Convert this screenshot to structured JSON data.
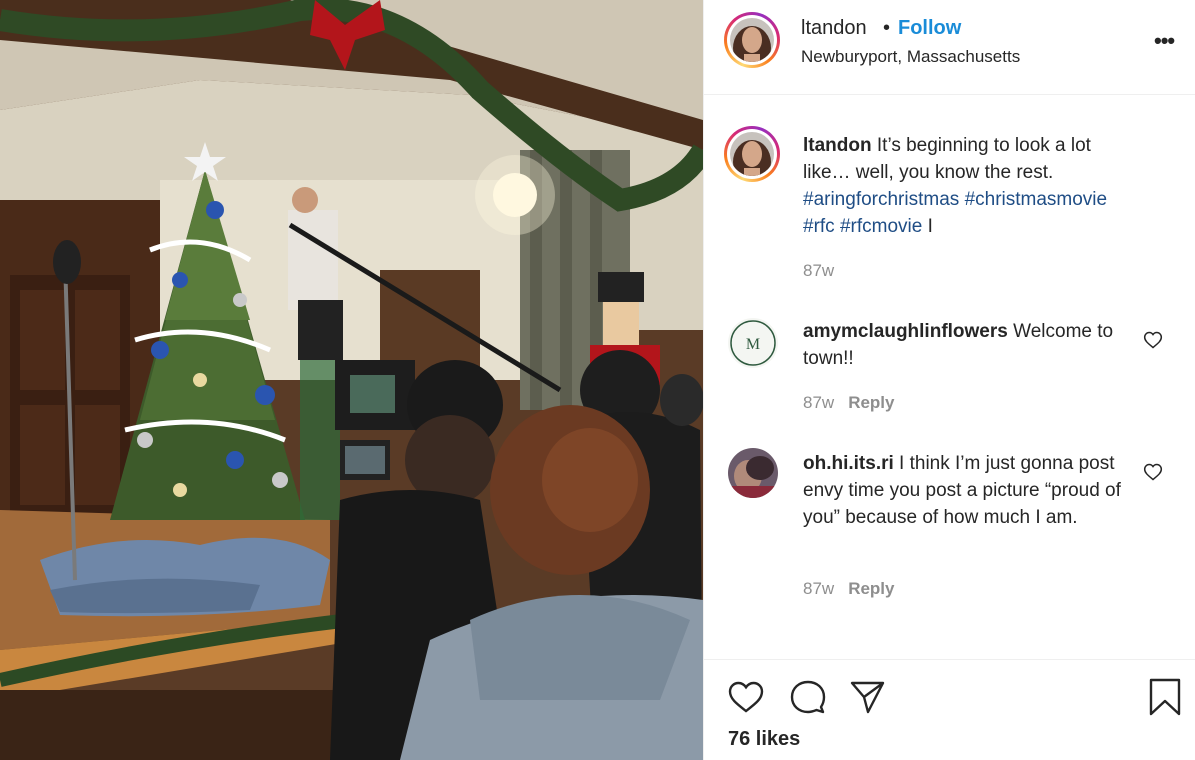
{
  "header": {
    "username": "ltandon",
    "separator": "•",
    "follow_label": "Follow",
    "location": "Newburyport, Massachusetts",
    "more_label": "•••"
  },
  "caption": {
    "username": "ltandon",
    "text": " It’s beginning to look a lot like… well, you know the rest. ",
    "hashtags": [
      "#aringforchristmas",
      "#christmasmovie",
      "#rfc",
      "#rfcmovie"
    ],
    "trailing": " I",
    "time": "87w"
  },
  "comments": [
    {
      "username": "amymclaughlinflowers",
      "text": " Welcome to town!!",
      "time": "87w",
      "reply_label": "Reply"
    },
    {
      "username": "oh.hi.its.ri",
      "text": " I think I’m just gonna post envy time you post a picture “proud of you” because of how much I am.",
      "time": "87w",
      "reply_label": "Reply"
    }
  ],
  "actions": {
    "icons": [
      "heart-icon",
      "comment-icon",
      "share-icon",
      "bookmark-icon"
    ],
    "likes": "76 likes"
  },
  "colors": {
    "follow": "#1a8cd8",
    "hashtag": "#1f4d85",
    "muted": "#8e8e8e",
    "text": "#262626",
    "border": "#efefef"
  }
}
